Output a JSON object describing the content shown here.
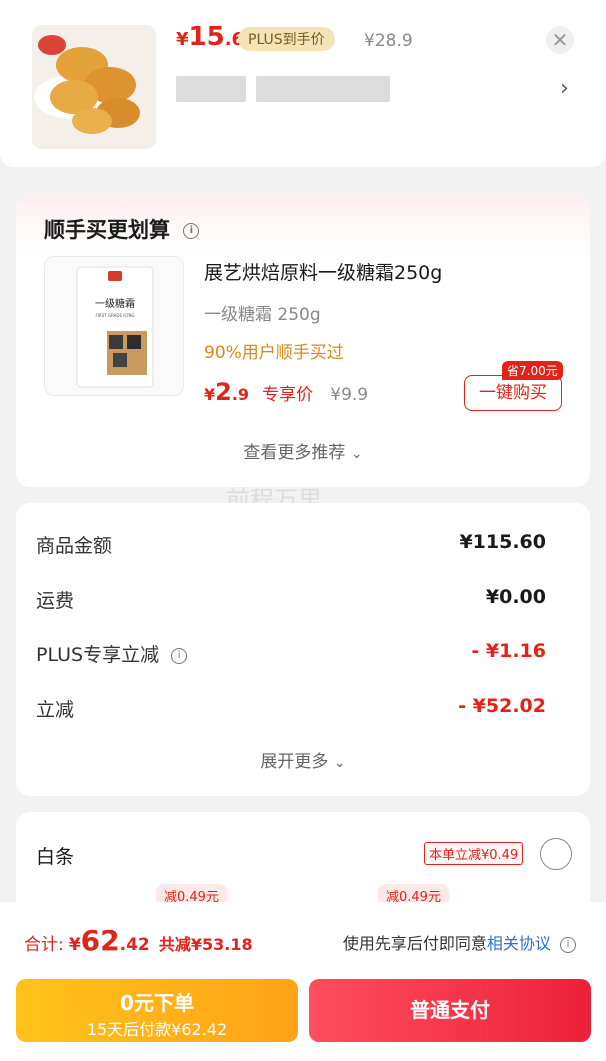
{
  "top_product": {
    "currency": "¥",
    "price_int": "15",
    "price_dec": ".6",
    "plus_badge": "PLUS到手价",
    "original_price": "¥28.9",
    "close_icon": "close-icon",
    "chevron_icon": "chevron-right-icon"
  },
  "recommend": {
    "title": "顺手买更划算",
    "item_name": "展艺烘焙原料一级糖霜250g",
    "item_spec": "一级糖霜 250g",
    "social_proof": "90%用户顺手买过",
    "price_currency": "¥",
    "price_int": "2",
    "price_dec": ".9",
    "price_label": "专享价",
    "original_price": "¥9.9",
    "save_tag": "省7.00元",
    "buy_button": "一键购买",
    "more_link": "查看更多推荐",
    "package_text_main": "一级糖霜",
    "package_text_sub": "FIRST GRADE ICING",
    "package_brand": "展艺"
  },
  "summary": {
    "rows": [
      {
        "label": "商品金额",
        "value": "¥115.60"
      },
      {
        "label": "运费",
        "value": "¥0.00"
      },
      {
        "label": "PLUS专享立减",
        "value": "- ¥1.16"
      },
      {
        "label": "立减",
        "value": "- ¥52.02"
      }
    ],
    "expand_link": "展开更多"
  },
  "baitiao": {
    "title": "白条",
    "reduce_tag": "本单立减¥0.49",
    "option_tags": [
      "减0.49元",
      "减0.49元"
    ]
  },
  "bottom": {
    "total_label": "合计:",
    "total_currency": "¥",
    "total_int": "62",
    "total_dec": ".42",
    "discount_text": "共减¥53.18",
    "agree_prefix": "使用先享后付即同意",
    "agree_link": "相关协议",
    "btn_zero_title": "0元下单",
    "btn_zero_sub": "15天后付款¥62.42",
    "btn_normal": "普通支付"
  },
  "watermark": "前程万里",
  "colors": {
    "accent_red": "#e2231a",
    "plus_gold": "#f5e3b8",
    "btn_yellow": "#ffb21a",
    "btn_red": "#f0334a"
  }
}
